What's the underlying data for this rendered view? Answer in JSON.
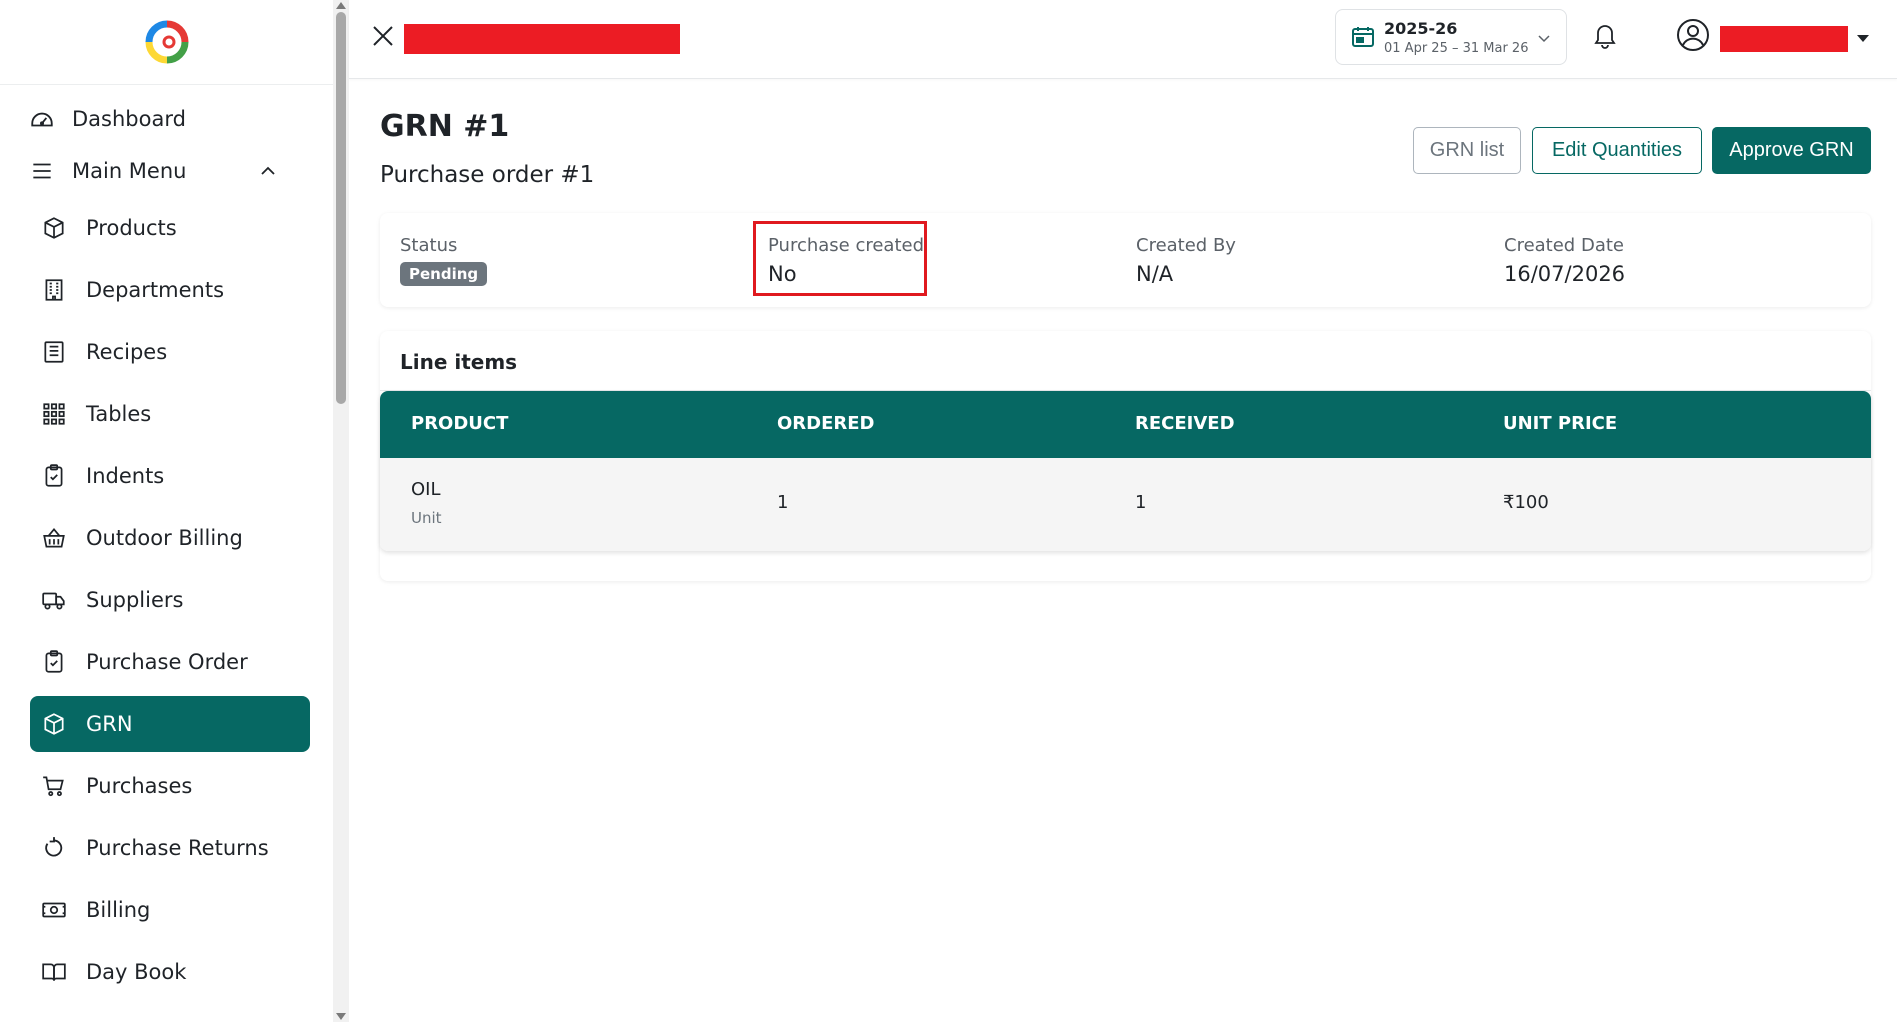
{
  "sidebar": {
    "items": [
      {
        "label": "Dashboard",
        "icon": "dashboard-icon"
      },
      {
        "label": "Main Menu",
        "icon": "menu-icon"
      },
      {
        "label": "Products",
        "icon": "box-icon"
      },
      {
        "label": "Departments",
        "icon": "building-icon"
      },
      {
        "label": "Recipes",
        "icon": "recipe-icon"
      },
      {
        "label": "Tables",
        "icon": "grid-icon"
      },
      {
        "label": "Indents",
        "icon": "clipboard-icon"
      },
      {
        "label": "Outdoor Billing",
        "icon": "basket-icon"
      },
      {
        "label": "Suppliers",
        "icon": "truck-icon"
      },
      {
        "label": "Purchase Order",
        "icon": "clipboard-check-icon"
      },
      {
        "label": "GRN",
        "icon": "box-icon"
      },
      {
        "label": "Purchases",
        "icon": "cart-icon"
      },
      {
        "label": "Purchase Returns",
        "icon": "return-icon"
      },
      {
        "label": "Billing",
        "icon": "cash-icon"
      },
      {
        "label": "Day Book",
        "icon": "book-icon"
      }
    ],
    "active": "GRN",
    "accent": "#066863"
  },
  "topbar": {
    "fy_year": "2025-26",
    "fy_range": "01 Apr 25 – 31 Mar 26"
  },
  "page": {
    "title": "GRN #1",
    "subtitle": "Purchase order #1",
    "buttons": {
      "grn_list": "GRN list",
      "edit_quantities": "Edit Quantities",
      "approve": "Approve GRN"
    }
  },
  "info": {
    "status_label": "Status",
    "status_value": "Pending",
    "purchase_created_label": "Purchase created",
    "purchase_created_value": "No",
    "created_by_label": "Created By",
    "created_by_value": "N/A",
    "created_date_label": "Created Date",
    "created_date_value": "16/07/2026"
  },
  "line_items": {
    "title": "Line items",
    "columns": [
      "PRODUCT",
      "ORDERED",
      "RECEIVED",
      "UNIT PRICE"
    ],
    "rows": [
      {
        "product": "OIL",
        "unit": "Unit",
        "ordered": "1",
        "received": "1",
        "unit_price": "₹100"
      }
    ]
  }
}
